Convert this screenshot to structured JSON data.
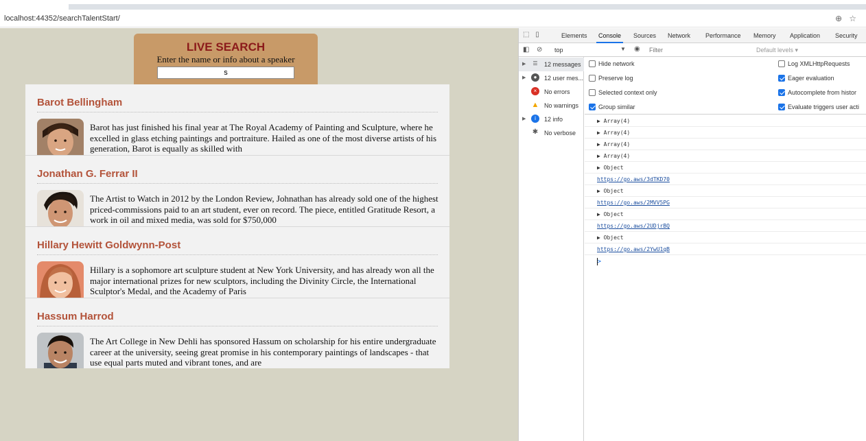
{
  "browser": {
    "url": "localhost:44352/searchTalentStart/",
    "icons": [
      "zoom-icon",
      "star-icon"
    ]
  },
  "search": {
    "title": "LIVE SEARCH",
    "subtitle": "Enter the name or info about a speaker",
    "value": "s"
  },
  "results": [
    {
      "name": "Barot Bellingham",
      "desc": "Barot has just finished his final year at The Royal Academy of Painting and Sculpture, where he excelled in glass etching paintings and portraiture. Hailed as one of the most diverse artists of his generation, Barot is equally as skilled with"
    },
    {
      "name": "Jonathan G. Ferrar II",
      "desc": "The Artist to Watch in 2012 by the London Review, Johnathan has already sold one of the highest priced-commissions paid to an art student, ever on record. The piece, entitled Gratitude Resort, a work in oil and mixed media, was sold for $750,000"
    },
    {
      "name": "Hillary Hewitt Goldwynn-Post",
      "desc": "Hillary is a sophomore art sculpture student at New York University, and has already won all the major international prizes for new sculptors, including the Divinity Circle, the International Sculptor's Medal, and the Academy of Paris"
    },
    {
      "name": "Hassum Harrod",
      "desc": "The Art College in New Dehli has sponsored Hassum on scholarship for his entire undergraduate career at the university, seeing great promise in his contemporary paintings of landscapes - that use equal parts muted and vibrant tones, and are"
    }
  ],
  "devtools": {
    "tabs": [
      "Elements",
      "Console",
      "Sources",
      "Network",
      "Performance",
      "Memory",
      "Application",
      "Security"
    ],
    "active_tab": "Console",
    "context": "top",
    "filter_placeholder": "Filter",
    "levels": "Default levels ▾",
    "sidebar": [
      {
        "label": "12 messages",
        "icon": "list-icon"
      },
      {
        "label": "12 user mes...",
        "icon": "user-icon"
      },
      {
        "label": "No errors",
        "icon": "error-icon"
      },
      {
        "label": "No warnings",
        "icon": "warning-icon"
      },
      {
        "label": "12 info",
        "icon": "info-icon"
      },
      {
        "label": "No verbose",
        "icon": "bug-icon"
      }
    ],
    "settings_left": [
      {
        "label": "Hide network",
        "checked": false
      },
      {
        "label": "Preserve log",
        "checked": false
      },
      {
        "label": "Selected context only",
        "checked": false
      },
      {
        "label": "Group similar",
        "checked": true
      }
    ],
    "settings_right": [
      {
        "label": "Log XMLHttpRequests",
        "checked": false
      },
      {
        "label": "Eager evaluation",
        "checked": true
      },
      {
        "label": "Autocomplete from histor",
        "checked": true
      },
      {
        "label": "Evaluate triggers user acti",
        "checked": true
      }
    ],
    "logs": [
      {
        "text": "▶ Array(4)",
        "link": false
      },
      {
        "text": "▶ Array(4)",
        "link": false
      },
      {
        "text": "▶ Array(4)",
        "link": false
      },
      {
        "text": "▶ Array(4)",
        "link": false
      },
      {
        "text": "▶ Object",
        "link": false
      },
      {
        "text": "https://go.aws/3dTKD70",
        "link": true
      },
      {
        "text": "▶ Object",
        "link": false
      },
      {
        "text": "https://go.aws/2MVV5PG",
        "link": true
      },
      {
        "text": "▶ Object",
        "link": false
      },
      {
        "text": "https://go.aws/2UDjrBQ",
        "link": true
      },
      {
        "text": "▶ Object",
        "link": false
      },
      {
        "text": "https://go.aws/2YwU1qB",
        "link": true
      }
    ],
    "prompt": ">"
  }
}
